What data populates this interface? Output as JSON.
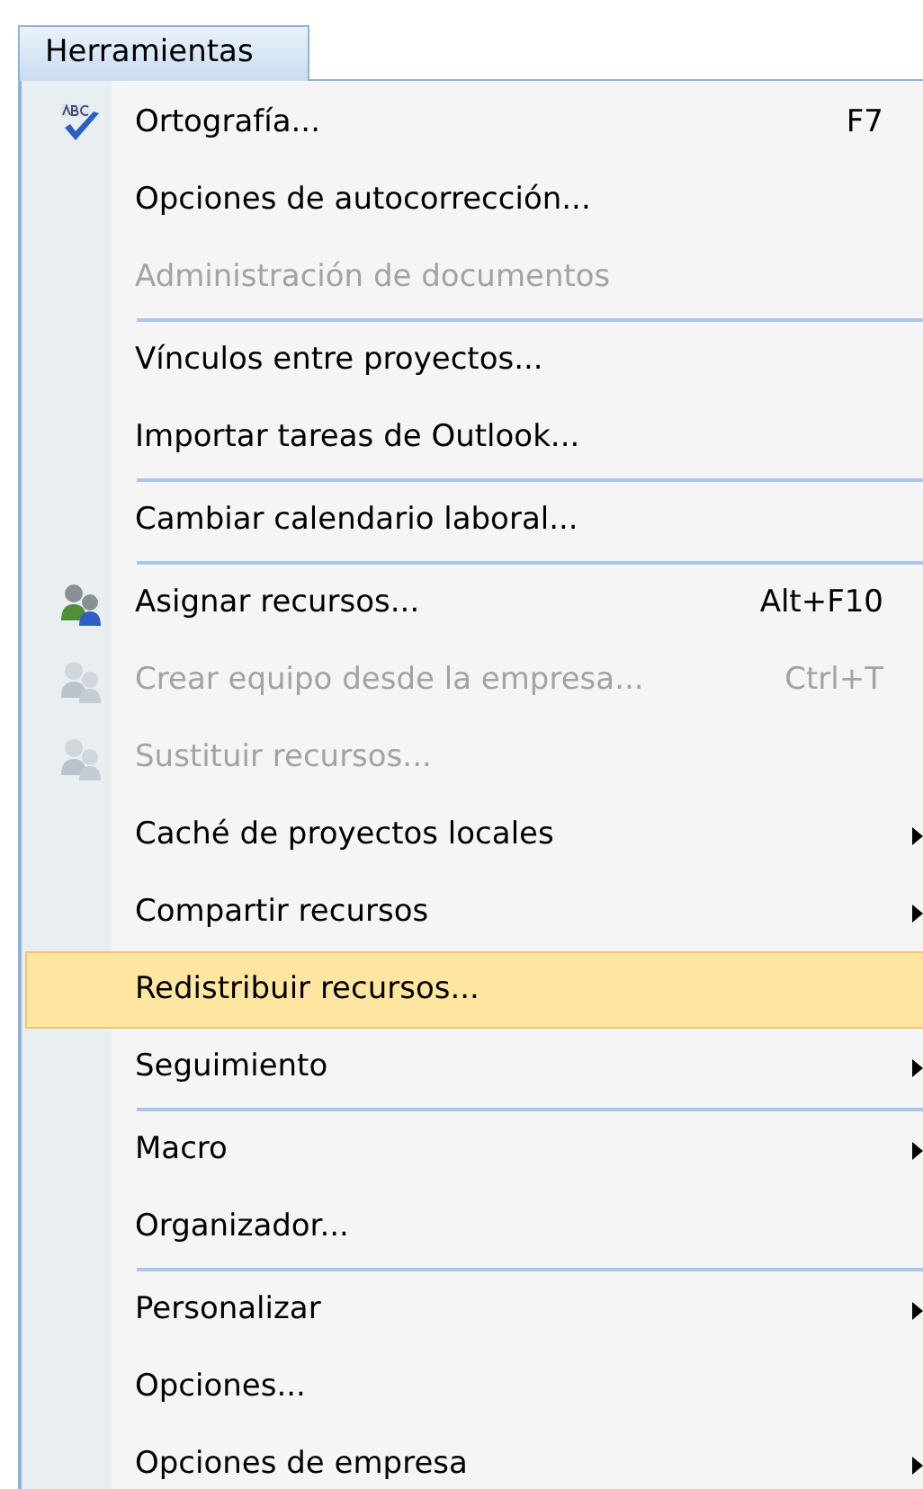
{
  "menu_bar": {
    "title": "Herramientas",
    "open": true
  },
  "menu": [
    {
      "kind": "item",
      "label": "Ortografía...",
      "shortcut": "F7",
      "submenu": false,
      "disabled": false,
      "selected": false
    },
    {
      "kind": "item",
      "label": "Opciones de autocorrección...",
      "submenu": false,
      "disabled": false,
      "selected": false
    },
    {
      "kind": "item",
      "label": "Administración de documentos",
      "submenu": false,
      "disabled": true,
      "selected": false
    },
    {
      "kind": "separator"
    },
    {
      "kind": "item",
      "label": "Vínculos entre proyectos...",
      "submenu": false,
      "disabled": false,
      "selected": false
    },
    {
      "kind": "item",
      "label": "Importar tareas de Outlook...",
      "submenu": false,
      "disabled": false,
      "selected": false
    },
    {
      "kind": "separator"
    },
    {
      "kind": "item",
      "label": "Cambiar calendario laboral...",
      "submenu": false,
      "disabled": false,
      "selected": false
    },
    {
      "kind": "separator"
    },
    {
      "kind": "item",
      "label": "Asignar recursos...",
      "shortcut": "Alt+F10",
      "submenu": false,
      "disabled": false,
      "selected": false
    },
    {
      "kind": "item",
      "label": "Crear equipo desde la empresa...",
      "shortcut": "Ctrl+T",
      "submenu": false,
      "disabled": true,
      "selected": false
    },
    {
      "kind": "item",
      "label": "Sustituir recursos...",
      "submenu": false,
      "disabled": true,
      "selected": false
    },
    {
      "kind": "item",
      "label": "Caché de proyectos locales",
      "submenu": true,
      "disabled": false,
      "selected": false
    },
    {
      "kind": "item",
      "label": "Compartir recursos",
      "submenu": true,
      "disabled": false,
      "selected": false
    },
    {
      "kind": "item",
      "label": "Redistribuir recursos...",
      "submenu": false,
      "disabled": false,
      "selected": true
    },
    {
      "kind": "item",
      "label": "Seguimiento",
      "submenu": true,
      "disabled": false,
      "selected": false
    },
    {
      "kind": "separator"
    },
    {
      "kind": "item",
      "label": "Macro",
      "submenu": true,
      "disabled": false,
      "selected": false
    },
    {
      "kind": "item",
      "label": "Organizador...",
      "submenu": false,
      "disabled": false,
      "selected": false
    },
    {
      "kind": "separator"
    },
    {
      "kind": "item",
      "label": "Personalizar",
      "submenu": true,
      "disabled": false,
      "selected": false
    },
    {
      "kind": "item",
      "label": "Opciones...",
      "submenu": false,
      "disabled": false,
      "selected": false
    },
    {
      "kind": "item",
      "label": "Opciones de empresa",
      "submenu": true,
      "disabled": false,
      "selected": false
    }
  ]
}
